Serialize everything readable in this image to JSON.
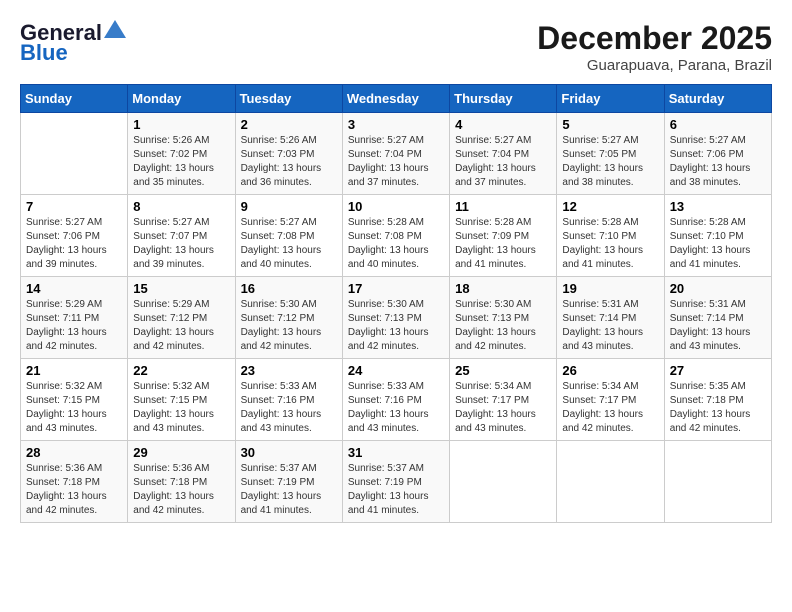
{
  "logo": {
    "line1": "General",
    "line2": "Blue"
  },
  "title": "December 2025",
  "location": "Guarapuava, Parana, Brazil",
  "headers": [
    "Sunday",
    "Monday",
    "Tuesday",
    "Wednesday",
    "Thursday",
    "Friday",
    "Saturday"
  ],
  "weeks": [
    [
      {
        "day": "",
        "info": ""
      },
      {
        "day": "1",
        "info": "Sunrise: 5:26 AM\nSunset: 7:02 PM\nDaylight: 13 hours\nand 35 minutes."
      },
      {
        "day": "2",
        "info": "Sunrise: 5:26 AM\nSunset: 7:03 PM\nDaylight: 13 hours\nand 36 minutes."
      },
      {
        "day": "3",
        "info": "Sunrise: 5:27 AM\nSunset: 7:04 PM\nDaylight: 13 hours\nand 37 minutes."
      },
      {
        "day": "4",
        "info": "Sunrise: 5:27 AM\nSunset: 7:04 PM\nDaylight: 13 hours\nand 37 minutes."
      },
      {
        "day": "5",
        "info": "Sunrise: 5:27 AM\nSunset: 7:05 PM\nDaylight: 13 hours\nand 38 minutes."
      },
      {
        "day": "6",
        "info": "Sunrise: 5:27 AM\nSunset: 7:06 PM\nDaylight: 13 hours\nand 38 minutes."
      }
    ],
    [
      {
        "day": "7",
        "info": "Sunrise: 5:27 AM\nSunset: 7:06 PM\nDaylight: 13 hours\nand 39 minutes."
      },
      {
        "day": "8",
        "info": "Sunrise: 5:27 AM\nSunset: 7:07 PM\nDaylight: 13 hours\nand 39 minutes."
      },
      {
        "day": "9",
        "info": "Sunrise: 5:27 AM\nSunset: 7:08 PM\nDaylight: 13 hours\nand 40 minutes."
      },
      {
        "day": "10",
        "info": "Sunrise: 5:28 AM\nSunset: 7:08 PM\nDaylight: 13 hours\nand 40 minutes."
      },
      {
        "day": "11",
        "info": "Sunrise: 5:28 AM\nSunset: 7:09 PM\nDaylight: 13 hours\nand 41 minutes."
      },
      {
        "day": "12",
        "info": "Sunrise: 5:28 AM\nSunset: 7:10 PM\nDaylight: 13 hours\nand 41 minutes."
      },
      {
        "day": "13",
        "info": "Sunrise: 5:28 AM\nSunset: 7:10 PM\nDaylight: 13 hours\nand 41 minutes."
      }
    ],
    [
      {
        "day": "14",
        "info": "Sunrise: 5:29 AM\nSunset: 7:11 PM\nDaylight: 13 hours\nand 42 minutes."
      },
      {
        "day": "15",
        "info": "Sunrise: 5:29 AM\nSunset: 7:12 PM\nDaylight: 13 hours\nand 42 minutes."
      },
      {
        "day": "16",
        "info": "Sunrise: 5:30 AM\nSunset: 7:12 PM\nDaylight: 13 hours\nand 42 minutes."
      },
      {
        "day": "17",
        "info": "Sunrise: 5:30 AM\nSunset: 7:13 PM\nDaylight: 13 hours\nand 42 minutes."
      },
      {
        "day": "18",
        "info": "Sunrise: 5:30 AM\nSunset: 7:13 PM\nDaylight: 13 hours\nand 42 minutes."
      },
      {
        "day": "19",
        "info": "Sunrise: 5:31 AM\nSunset: 7:14 PM\nDaylight: 13 hours\nand 43 minutes."
      },
      {
        "day": "20",
        "info": "Sunrise: 5:31 AM\nSunset: 7:14 PM\nDaylight: 13 hours\nand 43 minutes."
      }
    ],
    [
      {
        "day": "21",
        "info": "Sunrise: 5:32 AM\nSunset: 7:15 PM\nDaylight: 13 hours\nand 43 minutes."
      },
      {
        "day": "22",
        "info": "Sunrise: 5:32 AM\nSunset: 7:15 PM\nDaylight: 13 hours\nand 43 minutes."
      },
      {
        "day": "23",
        "info": "Sunrise: 5:33 AM\nSunset: 7:16 PM\nDaylight: 13 hours\nand 43 minutes."
      },
      {
        "day": "24",
        "info": "Sunrise: 5:33 AM\nSunset: 7:16 PM\nDaylight: 13 hours\nand 43 minutes."
      },
      {
        "day": "25",
        "info": "Sunrise: 5:34 AM\nSunset: 7:17 PM\nDaylight: 13 hours\nand 43 minutes."
      },
      {
        "day": "26",
        "info": "Sunrise: 5:34 AM\nSunset: 7:17 PM\nDaylight: 13 hours\nand 42 minutes."
      },
      {
        "day": "27",
        "info": "Sunrise: 5:35 AM\nSunset: 7:18 PM\nDaylight: 13 hours\nand 42 minutes."
      }
    ],
    [
      {
        "day": "28",
        "info": "Sunrise: 5:36 AM\nSunset: 7:18 PM\nDaylight: 13 hours\nand 42 minutes."
      },
      {
        "day": "29",
        "info": "Sunrise: 5:36 AM\nSunset: 7:18 PM\nDaylight: 13 hours\nand 42 minutes."
      },
      {
        "day": "30",
        "info": "Sunrise: 5:37 AM\nSunset: 7:19 PM\nDaylight: 13 hours\nand 41 minutes."
      },
      {
        "day": "31",
        "info": "Sunrise: 5:37 AM\nSunset: 7:19 PM\nDaylight: 13 hours\nand 41 minutes."
      },
      {
        "day": "",
        "info": ""
      },
      {
        "day": "",
        "info": ""
      },
      {
        "day": "",
        "info": ""
      }
    ]
  ]
}
